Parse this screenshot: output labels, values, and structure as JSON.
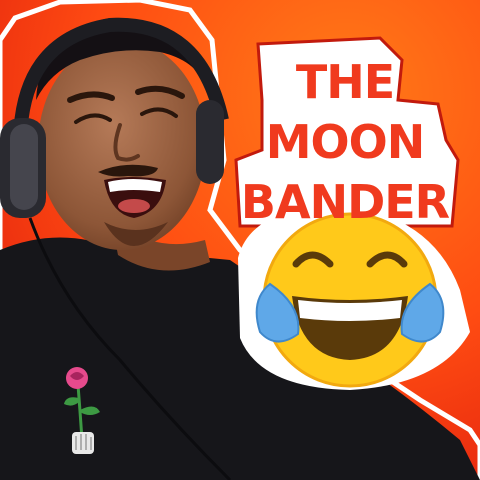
{
  "thumbnail": {
    "title_lines": [
      "THE",
      "MOON",
      "BANDER"
    ]
  },
  "colors": {
    "background_orange": "#ff5a12",
    "background_red": "#e8210f",
    "title_red": "#f03a1e",
    "label_white": "#ffffff",
    "emoji_yellow": "#ffc91a",
    "tear_blue": "#5fa8e8",
    "shirt_black": "#16161a"
  },
  "icons": {
    "emoji": "face-with-tears-of-joy-icon",
    "shirt_graphic": "rose-hand-icon"
  }
}
